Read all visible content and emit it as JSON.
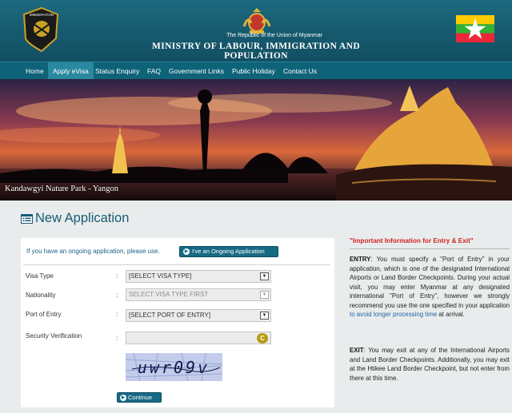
{
  "header": {
    "republic_text": "The Republic of the Union of Myanmar",
    "ministry_text": "MINISTRY OF  LABOUR, IMMIGRATION AND POPULATION",
    "logo_text": "IMMIGRATION"
  },
  "nav": {
    "items": [
      {
        "label": "Home"
      },
      {
        "label": "Apply eVisa",
        "active": true
      },
      {
        "label": "Status Enquiry"
      },
      {
        "label": "FAQ"
      },
      {
        "label": "Government Links"
      },
      {
        "label": "Public Holiday"
      },
      {
        "label": "Contact Us"
      }
    ]
  },
  "banner": {
    "caption": "Kandawgyi Nature Park - Yangon"
  },
  "page": {
    "title": "New Application"
  },
  "form": {
    "ongoing_text": "If you have an ongoing application, please use.",
    "ongoing_button": "I've an Ongoing Application",
    "visa_type_label": "Visa Type",
    "visa_type_value": "[SELECT VISA TYPE]",
    "nationality_label": "Nationality",
    "nationality_value": "SELECT VISA TYPE FIRST",
    "port_label": "Port of Entry",
    "port_value": "[SELECT PORT OF ENTRY]",
    "security_label": "Security Verification",
    "colon": ":",
    "captcha_text": "uwr09v",
    "continue_button": "Continue"
  },
  "info": {
    "title": "\"Important Information for Entry & Exit\"",
    "entry_label": "ENTRY",
    "entry_text": ": You must specify a \"Port of Entry\" in your application, which is one of the designated International Airports or Land Border Checkpoints. During your actual visit, you may enter Myanmar at any designated international \"Port of Entry\", however we strongly recommend you use the one specified in your application ",
    "entry_link": "to avoid longer processing time",
    "entry_tail": " at arrival.",
    "exit_label": "EXIT",
    "exit_text": ": You may exit at any of the International Airports and Land Border Checkpoints. Additionally, you may exit at the Htikee Land Border Checkpoint, but not enter from there at this time."
  },
  "colors": {
    "header_bg": "#1d6a80",
    "nav_bg": "#0e6379",
    "button_bg": "#176a84",
    "title_color": "#175a76",
    "info_title_red": "#d12323"
  }
}
